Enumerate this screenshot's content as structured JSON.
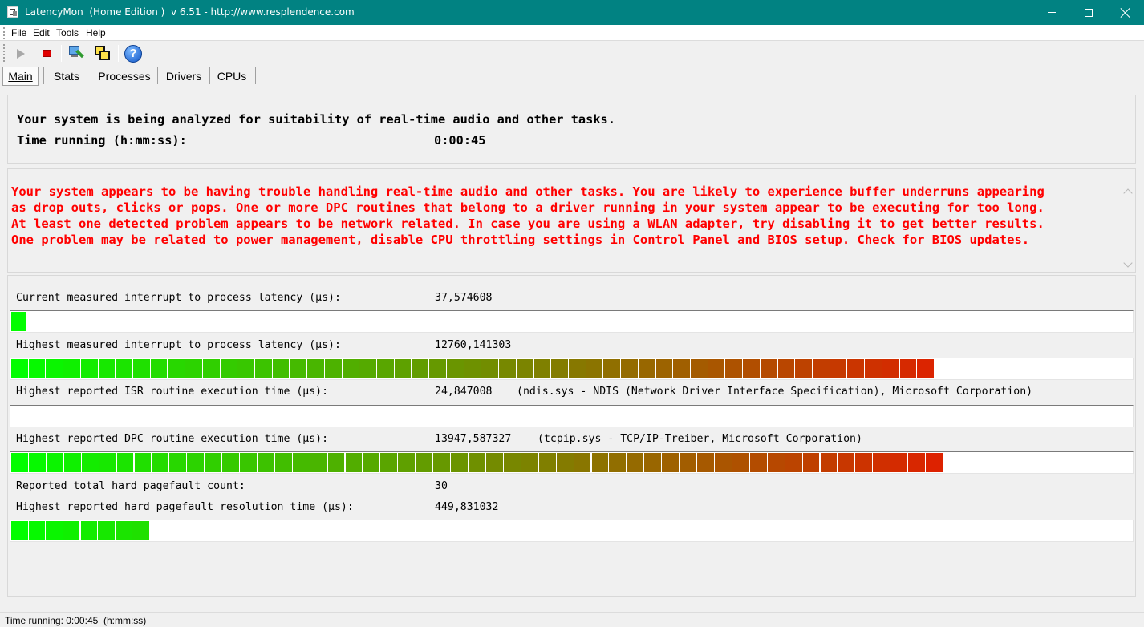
{
  "window": {
    "title": "LatencyMon  (Home Edition )  v 6.51 - http://www.resplendence.com",
    "app_icon": "latencymon-app-icon",
    "title_bar_color": "#018282"
  },
  "menu": {
    "items": [
      "File",
      "Edit",
      "Tools",
      "Help"
    ]
  },
  "toolbar": {
    "buttons": [
      {
        "name": "start",
        "icon": "play-icon",
        "state": "disabled"
      },
      {
        "name": "stop",
        "icon": "stop-icon",
        "state": "enabled"
      },
      {
        "name": "monitor",
        "icon": "monitor-pen-icon"
      },
      {
        "name": "windows",
        "icon": "windows-icon"
      },
      {
        "name": "help",
        "icon": "help-icon",
        "glyph": "?"
      }
    ]
  },
  "tabs": {
    "items": [
      "Main",
      "Stats",
      "Processes",
      "Drivers",
      "CPUs"
    ],
    "active": "Main"
  },
  "header": {
    "analysis_text": "Your system is being analyzed for suitability of real-time audio and other tasks.",
    "time_label": "Time running (h:mm:ss):",
    "time_value": "0:00:45"
  },
  "message": {
    "color": "#ff0000",
    "lines": [
      "Your system appears to be having trouble handling real-time audio and other tasks. You are likely to experience buffer underruns appearing",
      "as drop outs, clicks or pops. One or more DPC routines that belong to a driver running in your system appear to be executing for too long.",
      "At least one detected problem appears to be network related. In case you are using a WLAN adapter, try disabling it to get better results.",
      "One problem may be related to power management, disable CPU throttling settings in Control Panel and BIOS setup. Check for BIOS updates."
    ]
  },
  "stats": [
    {
      "label": "Current measured interrupt to process latency (µs):",
      "value": "37,574608",
      "detail": "",
      "bar_fraction": 0.014,
      "bar_segments": 1
    },
    {
      "label": "Highest measured interrupt to process latency (µs):",
      "value": "12760,141303",
      "detail": "",
      "bar_fraction": 0.824,
      "bar_segments": 53
    },
    {
      "label": "Highest reported ISR routine execution time (µs):",
      "value": "24,847008",
      "detail": "(ndis.sys - NDIS (Network Driver Interface Specification), Microsoft Corporation)",
      "bar_fraction": 0.0,
      "bar_segments": 0
    },
    {
      "label": "Highest reported DPC routine execution time (µs):",
      "value": "13947,587327",
      "detail": "(tcpip.sys - TCP/IP-Treiber, Microsoft Corporation)",
      "bar_fraction": 0.832,
      "bar_segments": 53
    },
    {
      "label": "Reported total hard pagefault count:",
      "value": "30",
      "detail": "",
      "bar_fraction": null,
      "bar_segments": null
    },
    {
      "label": "Highest reported hard pagefault resolution time (µs):",
      "value": "449,831032",
      "detail": "",
      "bar_fraction": 0.124,
      "bar_segments": 8
    }
  ],
  "bar_colors": {
    "start": "#00ff00",
    "end": "#ff0000",
    "track": "#ffffff"
  },
  "statusbar": {
    "text": "Time running: 0:00:45  (h:mm:ss)"
  }
}
